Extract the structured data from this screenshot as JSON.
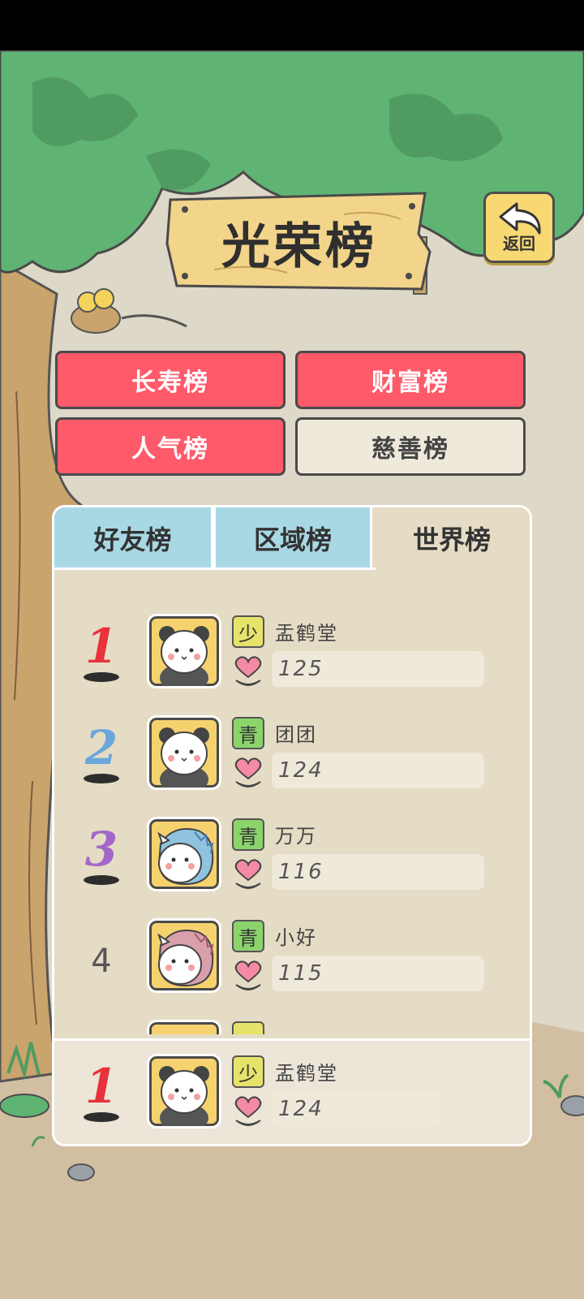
{
  "header": {
    "title": "光荣榜",
    "back_label": "返回"
  },
  "categories": [
    {
      "label": "长寿榜",
      "active": true
    },
    {
      "label": "财富榜",
      "active": true
    },
    {
      "label": "人气榜",
      "active": true
    },
    {
      "label": "慈善榜",
      "active": false
    }
  ],
  "tabs": [
    {
      "label": "好友榜",
      "selected": false
    },
    {
      "label": "区域榜",
      "selected": false
    },
    {
      "label": "世界榜",
      "selected": true
    }
  ],
  "ranking": [
    {
      "rank": "1",
      "badge": "少",
      "name": "盂鹤堂",
      "score": "125",
      "avatar": "panda-avatar"
    },
    {
      "rank": "2",
      "badge": "青",
      "name": "团团",
      "score": "124",
      "avatar": "panda-avatar"
    },
    {
      "rank": "3",
      "badge": "青",
      "name": "万万",
      "score": "116",
      "avatar": "blue-dragon-avatar"
    },
    {
      "rank": "4",
      "badge": "青",
      "name": "小好",
      "score": "115",
      "avatar": "pink-dragon-avatar"
    }
  ],
  "my_rank": {
    "rank": "1",
    "badge": "少",
    "name": "盂鹤堂",
    "score": "124",
    "avatar": "panda-avatar"
  },
  "colors": {
    "rank1": "#e8323c",
    "rank2": "#6aa7dd",
    "rank3": "#a267c9",
    "button_red": "#ff5a6a",
    "tab_blue": "#a9d8e5",
    "badge_young": "#e6e36a",
    "badge_youth": "#8bd46c"
  }
}
